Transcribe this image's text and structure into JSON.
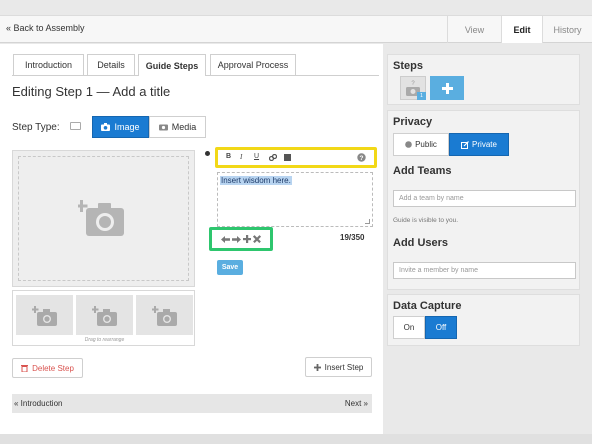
{
  "topbar": {
    "back_label": "« Back to Assembly",
    "nav": [
      "View",
      "Edit",
      "History"
    ],
    "active_nav": "Edit"
  },
  "tabs": [
    "Introduction",
    "Details",
    "Guide Steps",
    "Approval Process"
  ],
  "active_tab": "Guide Steps",
  "page_title": "Editing Step 1 — Add a title",
  "step_type": {
    "label": "Step Type:",
    "options": [
      "Image",
      "Media"
    ],
    "selected": "Image"
  },
  "thumbs_note": "Drag to rearrange",
  "editor": {
    "toolbar": [
      "B",
      "I",
      "U",
      "link",
      "image",
      "?"
    ],
    "text": "Insert wisdom here.",
    "char_count": "19/350",
    "save_label": "Save"
  },
  "actions": {
    "delete_label": "Delete Step",
    "insert_label": "Insert Step"
  },
  "pager": {
    "prev_label": "« Introduction",
    "next_label": "Next »"
  },
  "sidebar": {
    "steps_title": "Steps",
    "step_badge": "1",
    "privacy_title": "Privacy",
    "privacy_options": [
      "Public",
      "Private"
    ],
    "privacy_selected": "Private",
    "teams_title": "Add Teams",
    "teams_placeholder": "Add a team by name",
    "visibility_text": "Guide is visible to you.",
    "users_title": "Add Users",
    "users_placeholder": "Invite a member by name",
    "capture_title": "Data Capture",
    "capture_options": [
      "On",
      "Off"
    ],
    "capture_selected": "Off"
  },
  "colors": {
    "primary": "#1a7bd2",
    "save": "#5aaee0",
    "highlight_yellow": "#f2d817",
    "highlight_green": "#2ec66e",
    "delete": "#d9534f"
  }
}
